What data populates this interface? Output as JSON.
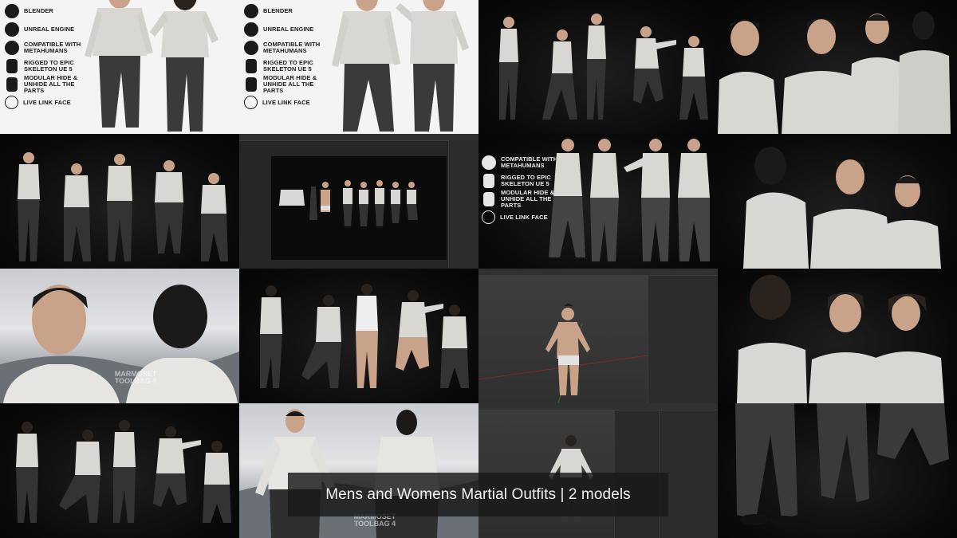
{
  "features_top": [
    {
      "icon": "blender-icon",
      "label": "BLENDER"
    },
    {
      "icon": "unreal-engine-icon",
      "label": "UNREAL ENGINE"
    },
    {
      "icon": "metahuman-icon",
      "label": "COMPATIBLE WITH METAHUMANS"
    },
    {
      "icon": "skeleton-icon",
      "label": "RIGGED TO EPIC SKELETON UE 5"
    },
    {
      "icon": "person-icon",
      "label": "MODULAR HIDE & UNHIDE ALL THE PARTS"
    },
    {
      "icon": "face-icon",
      "label": "LIVE LINK FACE"
    }
  ],
  "features_dark": [
    {
      "icon": "metahuman-icon",
      "label": "COMPATIBLE WITH METAHUMANS"
    },
    {
      "icon": "skeleton-icon",
      "label": "RIGGED TO EPIC SKELETON UE 5"
    },
    {
      "icon": "person-icon",
      "label": "MODULAR HIDE & UNHIDE ALL THE PARTS"
    },
    {
      "icon": "face-icon",
      "label": "LIVE LINK FACE"
    }
  ],
  "caption": "Mens and Womens Martial Outfits | 2 models",
  "watermark": "MARMOSET TOOLBAG 4",
  "colors": {
    "shirt": "#d9d7d3",
    "pants": "#3a3a3a",
    "skin": "#c9a28a",
    "hair": "#1c1a18",
    "ui_dark": "#262626",
    "caption_bg": "#191919"
  }
}
